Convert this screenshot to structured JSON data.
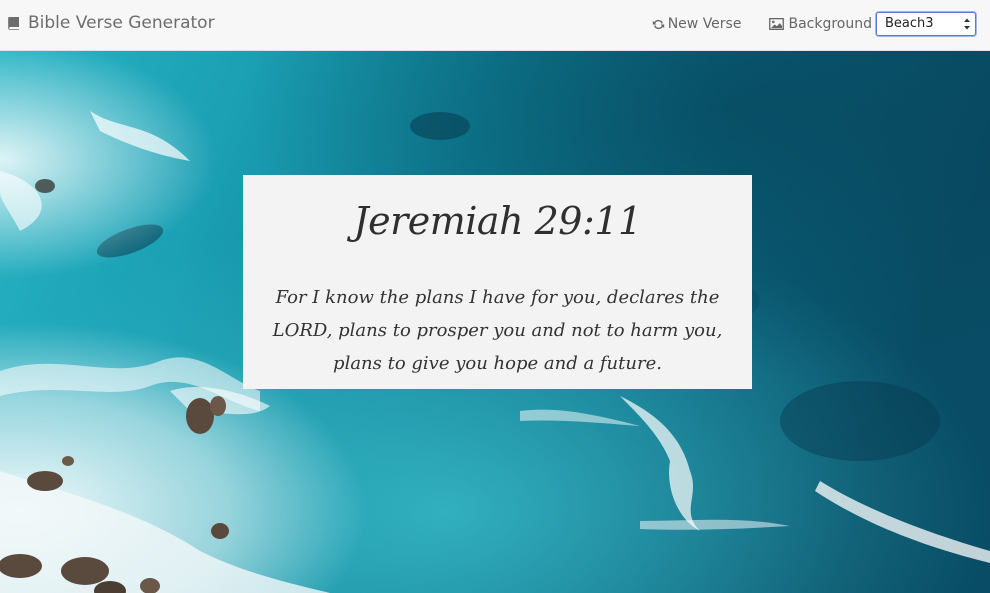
{
  "navbar": {
    "brand_label": "Bible Verse Generator",
    "brand_icon": "book-icon",
    "new_verse_label": "New Verse",
    "new_verse_icon": "refresh-icon",
    "background_label": "Background",
    "background_icon": "image-icon",
    "background_select_value": "Beach3"
  },
  "verse_card": {
    "reference": "Jeremiah 29:11",
    "text": "For I know the plans I have for you, declares the LORD, plans to prosper you and not to harm you, plans to give you hope and a future."
  },
  "colors": {
    "navbar_bg": "#f7f7f7",
    "card_bg": "#f3f3f3",
    "ocean_deep": "#0a4f63",
    "ocean_mid": "#0e7f95",
    "ocean_shallow": "#27b4c4",
    "foam": "#f2f6f7",
    "rock": "#5a4a3e"
  }
}
